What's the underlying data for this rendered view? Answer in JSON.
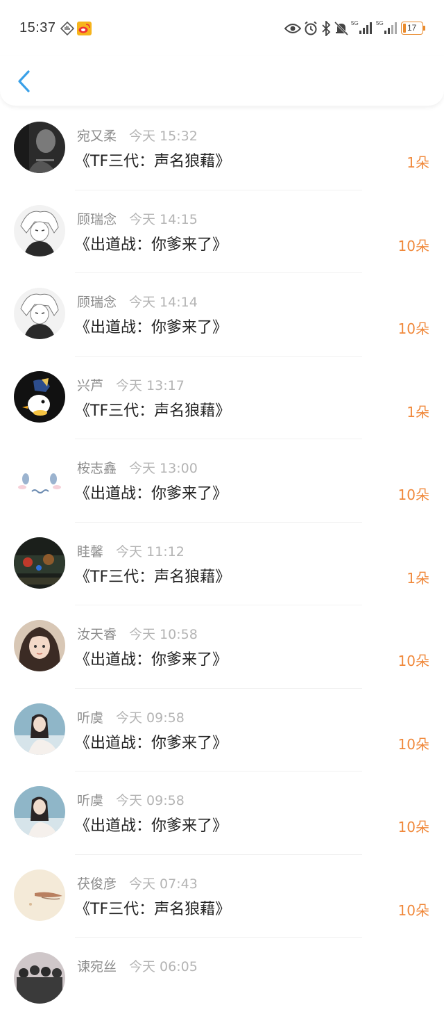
{
  "status_bar": {
    "time": "15:37",
    "battery": "17",
    "signal_1_label": "5G",
    "signal_2_label": "5G"
  },
  "header": {
    "back_icon": "chevron-left-icon"
  },
  "colors": {
    "accent": "#f0883a",
    "back": "#3aa0e8",
    "name": "#8c8c8c",
    "time": "#b4b4b4"
  },
  "items": [
    {
      "name": "宛又柔",
      "time": "今天 15:32",
      "gift": "《TF三代：声名狼藉》",
      "count": "1朵"
    },
    {
      "name": "顾瑞念",
      "time": "今天 14:15",
      "gift": "《出道战：你爹来了》",
      "count": "10朵"
    },
    {
      "name": "顾瑞念",
      "time": "今天 14:14",
      "gift": "《出道战：你爹来了》",
      "count": "10朵"
    },
    {
      "name": "兴芦",
      "time": "今天 13:17",
      "gift": "《TF三代：声名狼藉》",
      "count": "1朵"
    },
    {
      "name": "桉志鑫",
      "time": "今天 13:00",
      "gift": "《出道战：你爹来了》",
      "count": "10朵"
    },
    {
      "name": "眭馨",
      "time": "今天 11:12",
      "gift": "《TF三代：声名狼藉》",
      "count": "1朵"
    },
    {
      "name": "汝天睿",
      "time": "今天 10:58",
      "gift": "《出道战：你爹来了》",
      "count": "10朵"
    },
    {
      "name": "听虞",
      "time": "今天 09:58",
      "gift": "《出道战：你爹来了》",
      "count": "10朵"
    },
    {
      "name": "听虞",
      "time": "今天 09:58",
      "gift": "《出道战：你爹来了》",
      "count": "10朵"
    },
    {
      "name": "茯俊彦",
      "time": "今天 07:43",
      "gift": "《TF三代：声名狼藉》",
      "count": "10朵"
    },
    {
      "name": "谏宛丝",
      "time": "今天 06:05",
      "gift": "",
      "count": ""
    }
  ]
}
